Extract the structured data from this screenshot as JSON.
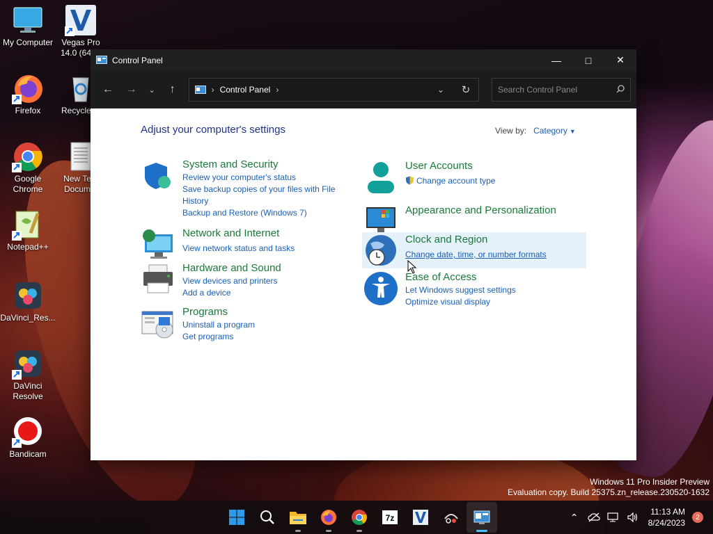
{
  "desktop": {
    "icons": [
      {
        "label": "My Computer",
        "icon": "monitor-icon"
      },
      {
        "label": "Vegas Pro 14.0 (64-...",
        "icon": "vegas-icon"
      },
      {
        "label": "Firefox",
        "icon": "firefox-icon"
      },
      {
        "label": "Recycle ...",
        "icon": "recycle-bin-icon"
      },
      {
        "label": "Google Chrome",
        "icon": "chrome-icon"
      },
      {
        "label": "New Te... Docum...",
        "icon": "text-document-icon"
      },
      {
        "label": "Notepad++",
        "icon": "notepadpp-icon"
      },
      {
        "label": "DaVinci_Res...",
        "icon": "davinci-icon"
      },
      {
        "label": "DaVinci Resolve",
        "icon": "davinci-icon"
      },
      {
        "label": "Bandicam",
        "icon": "bandicam-icon"
      }
    ],
    "watermark": {
      "line1": "Windows 11 Pro Insider Preview",
      "line2": "Evaluation copy. Build 25375.zn_release.230520-1632"
    }
  },
  "window": {
    "title": "Control Panel",
    "address": {
      "crumb": "Control Panel"
    },
    "search": {
      "placeholder": "Search Control Panel"
    },
    "heading": "Adjust your computer's settings",
    "view_by": {
      "label": "View by:",
      "value": "Category"
    },
    "categories_left": [
      {
        "title": "System and Security",
        "links": [
          "Review your computer's status",
          "Save backup copies of your files with File History",
          "Backup and Restore (Windows 7)"
        ]
      },
      {
        "title": "Network and Internet",
        "links": [
          "View network status and tasks"
        ]
      },
      {
        "title": "Hardware and Sound",
        "links": [
          "View devices and printers",
          "Add a device"
        ]
      },
      {
        "title": "Programs",
        "links": [
          "Uninstall a program",
          "Get programs"
        ]
      }
    ],
    "categories_right": [
      {
        "title": "User Accounts",
        "links": [
          "Change account type"
        ]
      },
      {
        "title": "Appearance and Personalization",
        "links": []
      },
      {
        "title": "Clock and Region",
        "links": [
          "Change date, time, or number formats"
        ]
      },
      {
        "title": "Ease of Access",
        "links": [
          "Let Windows suggest settings",
          "Optimize visual display"
        ]
      }
    ]
  },
  "taskbar": {
    "apps": [
      "start",
      "search",
      "file-explorer",
      "firefox",
      "chrome",
      "7zip",
      "vegas",
      "snipping",
      "control-panel"
    ],
    "clock": {
      "time": "11:13 AM",
      "date": "8/24/2023"
    },
    "notification_count": "2"
  },
  "colors": {
    "category_title": "#1a7a3a",
    "link": "#1a5fb4",
    "heading": "#1e3287",
    "titlebar": "#202020",
    "accent": "#4cc2ff"
  }
}
